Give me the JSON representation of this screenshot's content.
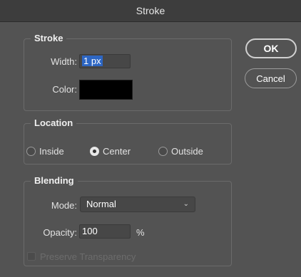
{
  "window": {
    "title": "Stroke"
  },
  "stroke_group": {
    "legend": "Stroke",
    "width_label": "Width:",
    "width_value": "1 px",
    "color_label": "Color:",
    "color_value": "#000000"
  },
  "location_group": {
    "legend": "Location",
    "options": [
      {
        "label": "Inside",
        "checked": false
      },
      {
        "label": "Center",
        "checked": true
      },
      {
        "label": "Outside",
        "checked": false
      }
    ]
  },
  "blending_group": {
    "legend": "Blending",
    "mode_label": "Mode:",
    "mode_value": "Normal",
    "opacity_label": "Opacity:",
    "opacity_value": "100",
    "opacity_unit": "%",
    "preserve_label": "Preserve Transparency",
    "preserve_checked": false
  },
  "buttons": {
    "ok": "OK",
    "cancel": "Cancel"
  }
}
